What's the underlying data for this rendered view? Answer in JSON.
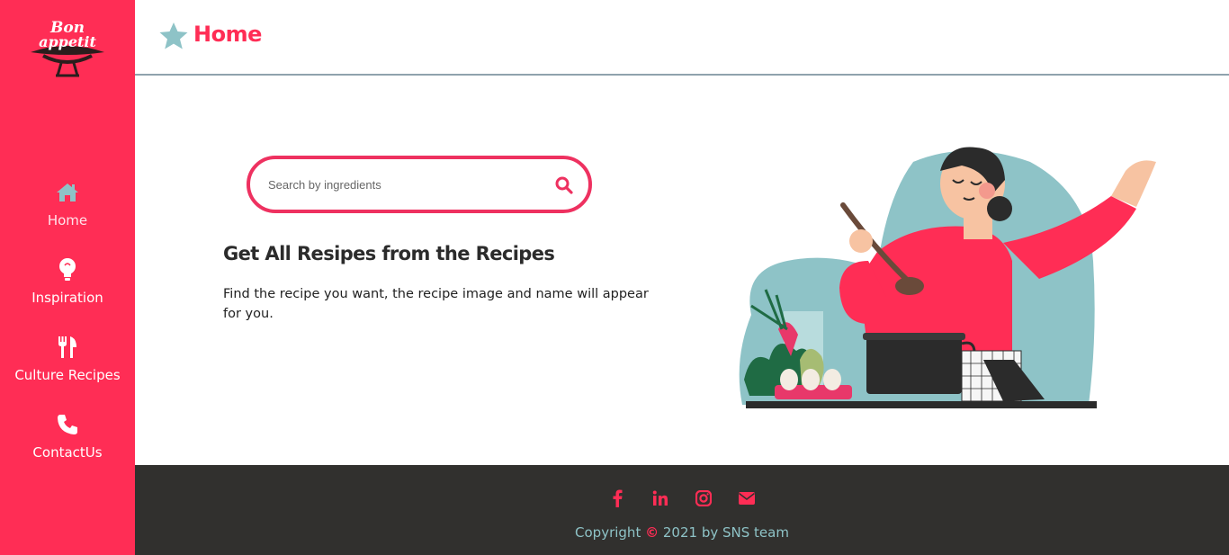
{
  "brand": {
    "logo_text": "Bon Appetit",
    "accent_color": "#ff2d55",
    "teal_color": "#8ec3c7"
  },
  "header": {
    "title": "Home",
    "icon": "star-icon"
  },
  "sidebar": {
    "items": [
      {
        "label": "Home",
        "icon": "home-icon",
        "active": true
      },
      {
        "label": "Inspiration",
        "icon": "lightbulb-icon"
      },
      {
        "label": "Culture Recipes",
        "icon": "utensils-icon"
      },
      {
        "label": "ContactUs",
        "icon": "phone-icon"
      }
    ]
  },
  "search": {
    "placeholder": "Search by ingredients",
    "value": ""
  },
  "main": {
    "heading": "Get All Resipes from the Recipes",
    "description": "Find the recipe you want, the recipe image and name will appear for you."
  },
  "footer": {
    "social": [
      "facebook-icon",
      "linkedin-icon",
      "instagram-icon",
      "envelope-icon"
    ],
    "copyright_prefix": "Copyright",
    "copyright_symbol": "©",
    "copyright_suffix": "2021 by SNS team"
  }
}
